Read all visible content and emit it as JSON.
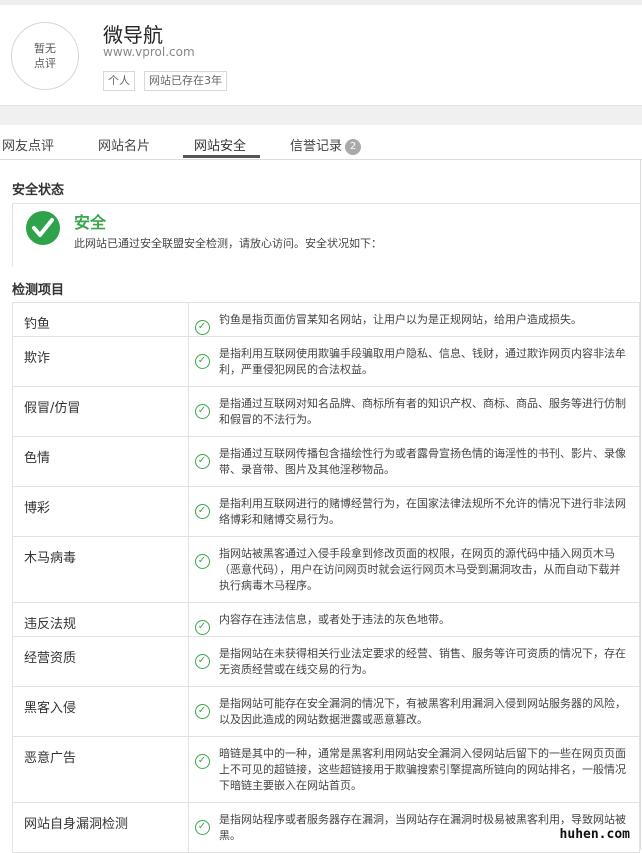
{
  "header": {
    "avatar_text_line1": "暂无",
    "avatar_text_line2": "点评",
    "site_name": "微导航",
    "site_url": "www.vprol.com",
    "tags": [
      "个人",
      "网站已存在3年"
    ]
  },
  "tabs": [
    {
      "label": "网友点评",
      "active": false
    },
    {
      "label": "网站名片",
      "active": false
    },
    {
      "label": "网站安全",
      "active": true
    },
    {
      "label": "信誉记录",
      "active": false,
      "badge": "2"
    }
  ],
  "security": {
    "status_title": "安全状态",
    "status_label": "安全",
    "status_desc": "此网站已通过安全联盟安全检测，请放心访问。安全状况如下：",
    "status_color": "#3aa64b",
    "checks_title": "检测项目",
    "items": [
      {
        "name": "钓鱼",
        "desc": "钓鱼是指页面仿冒某知名网站，让用户以为是正规网站，给用户造成损失。"
      },
      {
        "name": "欺诈",
        "desc": "是指利用互联网使用欺骗手段骗取用户隐私、信息、钱财，通过欺诈网页内容非法牟利，严重侵犯网民的合法权益。"
      },
      {
        "name": "假冒/仿冒",
        "desc": "是指通过互联网对知名品牌、商标所有者的知识产权、商标、商品、服务等进行仿制和假冒的不法行为。"
      },
      {
        "name": "色情",
        "desc": "是指通过互联网传播包含描绘性行为或者露骨宣扬色情的诲淫性的书刊、影片、录像带、录音带、图片及其他淫秽物品。"
      },
      {
        "name": "博彩",
        "desc": "是指利用互联网进行的赌博经营行为，在国家法律法规所不允许的情况下进行非法网络博彩和赌博交易行为。"
      },
      {
        "name": "木马病毒",
        "desc": "指网站被黑客通过入侵手段拿到修改页面的权限，在网页的源代码中插入网页木马（恶意代码），用户在访问网页时就会运行网页木马受到漏洞攻击，从而自动下载并执行病毒木马程序。"
      },
      {
        "name": "违反法规",
        "desc": "内容存在违法信息，或者处于违法的灰色地带。"
      },
      {
        "name": "经营资质",
        "desc": "是指网站在未获得相关行业法定要求的经营、销售、服务等许可资质的情况下，存在无资质经营或在线交易的行为。"
      },
      {
        "name": "黑客入侵",
        "desc": "是指网站可能存在安全漏洞的情况下，有被黑客利用漏洞入侵到网站服务器的风险，以及因此造成的网站数据泄露或恶意篡改。"
      },
      {
        "name": "恶意广告",
        "desc": "暗链是其中的一种，通常是黑客利用网站安全漏洞入侵网站后留下的一些在网页页面上不可见的超链接，这些超链接用于欺骗搜索引擎提高所链向的网站排名，一般情况下暗链主要嵌入在网站首页。"
      },
      {
        "name": "网站自身漏洞检测",
        "desc": "是指网站程序或者服务器存在漏洞，当网站存在漏洞时极易被黑客利用，导致网站被黑。"
      }
    ]
  },
  "watermark": "huhen.com"
}
